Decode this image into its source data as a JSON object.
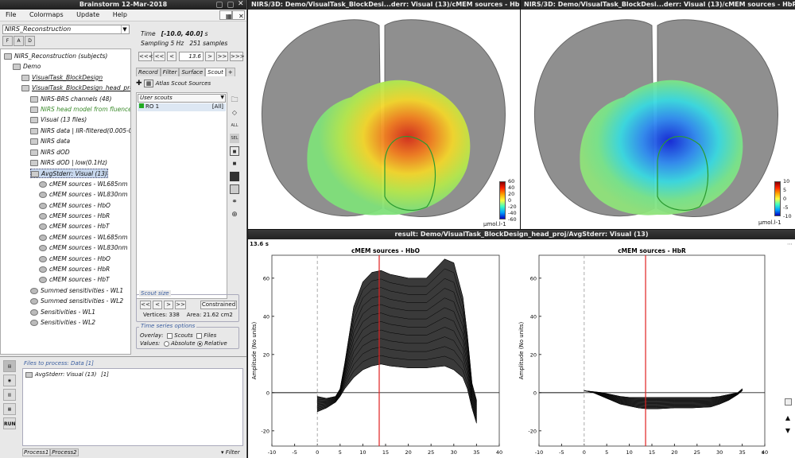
{
  "brainstorm": {
    "title": "Brainstorm 12-Mar-2018",
    "menu": [
      "File",
      "Colormaps",
      "Update",
      "Help"
    ],
    "protocol": "NIRS_Reconstruction",
    "tree": [
      {
        "label": "NIRS_Reconstruction (subjects)",
        "indent": 0,
        "icon": "db"
      },
      {
        "label": "Demo",
        "indent": 1,
        "icon": "subject"
      },
      {
        "label": "VisualTask_BlockDesign",
        "indent": 2,
        "icon": "folder",
        "und": true
      },
      {
        "label": "VisualTask_BlockDesign_head_proj",
        "indent": 2,
        "icon": "folder",
        "und": true
      },
      {
        "label": "NIRS-BRS channels (48)",
        "indent": 3,
        "icon": "chan"
      },
      {
        "label": "NIRS head model from fluence",
        "indent": 3,
        "icon": "head",
        "green": true
      },
      {
        "label": "Visual (13 files)",
        "indent": 3,
        "icon": "data"
      },
      {
        "label": "NIRS data | IIR-filtered(0.005-0.5Hz)",
        "indent": 3,
        "icon": "data"
      },
      {
        "label": "NIRS data",
        "indent": 3,
        "icon": "data"
      },
      {
        "label": "NIRS dOD",
        "indent": 3,
        "icon": "data"
      },
      {
        "label": "NIRS dOD | low(0.1Hz)",
        "indent": 3,
        "icon": "data"
      },
      {
        "label": "AvgStderr: Visual (13)",
        "indent": 3,
        "icon": "data",
        "sel": true
      },
      {
        "label": "cMEM sources - WL685nm",
        "indent": 4,
        "icon": "brain"
      },
      {
        "label": "cMEM sources - WL830nm",
        "indent": 4,
        "icon": "brain"
      },
      {
        "label": "cMEM sources - HbO",
        "indent": 4,
        "icon": "brain"
      },
      {
        "label": "cMEM sources - HbR",
        "indent": 4,
        "icon": "brain"
      },
      {
        "label": "cMEM sources - HbT",
        "indent": 4,
        "icon": "brain"
      },
      {
        "label": "cMEM sources - WL685nm",
        "indent": 4,
        "icon": "brain"
      },
      {
        "label": "cMEM sources - WL830nm",
        "indent": 4,
        "icon": "brain"
      },
      {
        "label": "cMEM sources - HbO",
        "indent": 4,
        "icon": "brain"
      },
      {
        "label": "cMEM sources - HbR",
        "indent": 4,
        "icon": "brain"
      },
      {
        "label": "cMEM sources - HbT",
        "indent": 4,
        "icon": "brain"
      },
      {
        "label": "Summed sensitivities - WL1",
        "indent": 3,
        "icon": "brain"
      },
      {
        "label": "Summed sensitivities - WL2",
        "indent": 3,
        "icon": "brain"
      },
      {
        "label": "Sensitivities - WL1",
        "indent": 3,
        "icon": "brain"
      },
      {
        "label": "Sensitivities - WL2",
        "indent": 3,
        "icon": "brain"
      }
    ],
    "time": {
      "label": "Time",
      "range": "[-10.0, 40.0]",
      "unit": "s",
      "sampling_label": "Sampling",
      "sampling": "5 Hz",
      "samples": "251 samples",
      "current": "13.6"
    },
    "nav_buttons": [
      "<<<",
      "<<",
      "<",
      ">",
      ">>",
      ">>>"
    ],
    "tabs": [
      "Record",
      "Filter",
      "Surface",
      "Scout",
      "+"
    ],
    "scout_toolbar": {
      "atlas": "Atlas",
      "scout": "Scout",
      "sources": "Sources"
    },
    "scout_combo": "User scouts",
    "scout_item": {
      "name": "RO 1",
      "value": "[All]"
    },
    "side_buttons": [
      "ALL",
      "SEL"
    ],
    "scout_size": {
      "title": "Scout size",
      "buttons": [
        "<<",
        "<",
        ">",
        ">>"
      ],
      "constrained": "Constrained",
      "vertices": "Vertices: 338",
      "area": "Area: 21.62 cm2"
    },
    "ts_options": {
      "title": "Time series options",
      "overlay": "Overlay:",
      "scouts": "Scouts",
      "files": "Files",
      "values": "Values:",
      "absolute": "Absolute",
      "relative": "Relative"
    },
    "files_to_process": {
      "title": "Files to process: Data [1]",
      "item": "AvgStderr: Visual (13)",
      "count": "[1]"
    },
    "process_tabs": [
      "Process1",
      "Process2"
    ],
    "filter": "Filter",
    "run": "RUN"
  },
  "fig_hbo": {
    "title": "NIRS/3D: Demo/VisualTask_BlockDesi...derr: Visual (13)/cMEM sources - HbO",
    "ticks": [
      "60",
      "40",
      "20",
      "0",
      "-20",
      "-40",
      "-60"
    ],
    "unit": "μmol.l-1"
  },
  "fig_hbr": {
    "title": "NIRS/3D: Demo/VisualTask_BlockDesi...derr: Visual (13)/cMEM sources - HbR",
    "ticks": [
      "10",
      "5",
      "0",
      "-5",
      "-10"
    ],
    "unit": "μmol.l-1"
  },
  "ts_window": {
    "title": "result: Demo/VisualTask_BlockDesign_head_proj/AvgStderr: Visual (13)",
    "time_label": "13.6 s",
    "xunit": "s"
  },
  "chart_data": [
    {
      "type": "line",
      "title": "cMEM sources - HbO",
      "ylabel": "Amplitude (No units)",
      "xlabel": "",
      "xlim": [
        -10,
        40
      ],
      "ylim": [
        -28,
        72
      ],
      "xticks": [
        -10,
        -5,
        0,
        5,
        10,
        15,
        20,
        25,
        30,
        35,
        40
      ],
      "yticks": [
        -20,
        0,
        20,
        40,
        60
      ],
      "cursor_x": 13.6,
      "envelope": {
        "x": [
          0,
          2,
          4,
          5,
          6,
          8,
          10,
          12,
          14,
          16,
          20,
          24,
          28,
          30,
          32,
          33,
          34,
          35
        ],
        "upper": [
          -2,
          -3,
          -2,
          2,
          15,
          45,
          58,
          63,
          64,
          62,
          60,
          60,
          70,
          68,
          50,
          30,
          5,
          -4
        ],
        "lower": [
          -10,
          -8,
          -5,
          -2,
          2,
          8,
          12,
          14,
          15,
          14,
          13,
          13,
          14,
          12,
          8,
          2,
          -8,
          -16
        ]
      }
    },
    {
      "type": "line",
      "title": "cMEM sources - HbR",
      "ylabel": "Amplitude (No units)",
      "xlabel": "",
      "xlim": [
        -10,
        40
      ],
      "ylim": [
        -28,
        72
      ],
      "xticks": [
        -10,
        -5,
        0,
        5,
        10,
        15,
        20,
        25,
        30,
        35,
        40
      ],
      "yticks": [
        -20,
        0,
        20,
        40,
        60
      ],
      "cursor_x": 13.6,
      "envelope": {
        "x": [
          0,
          2,
          4,
          6,
          8,
          10,
          12,
          14,
          16,
          20,
          24,
          28,
          30,
          32,
          34,
          35
        ],
        "upper": [
          1,
          0.5,
          0,
          -1,
          -2,
          -2.5,
          -2.5,
          -2.5,
          -2.5,
          -2.5,
          -2.5,
          -2.5,
          -2,
          -1,
          0,
          2
        ],
        "lower": [
          1,
          0,
          -2,
          -4,
          -6,
          -7,
          -8,
          -8.5,
          -8.5,
          -8,
          -8,
          -7.5,
          -6,
          -4,
          -1,
          1
        ]
      }
    }
  ]
}
